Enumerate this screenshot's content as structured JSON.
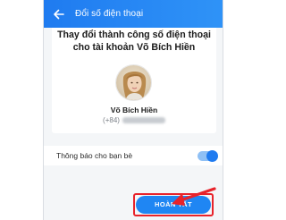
{
  "header": {
    "back_icon": "arrow-left-icon",
    "title": "Đổi số điện thoại"
  },
  "main": {
    "message": "Thay đổi thành công số điện thoại cho tài khoản Võ Bích Hiền",
    "profile": {
      "avatar_icon": "user-avatar-photo",
      "name": "Võ Bích Hiền",
      "phone_prefix": "(+84)"
    },
    "notify": {
      "label": "Thông báo cho bạn bè",
      "enabled": true
    },
    "done_label": "HOÀN TẤT"
  },
  "annotation": {
    "highlight_color": "#e8232b",
    "arrow_icon": "red-pointer-arrow"
  },
  "colors": {
    "accent": "#1f7bf0",
    "header_gradient_end": "#2f93f7"
  }
}
